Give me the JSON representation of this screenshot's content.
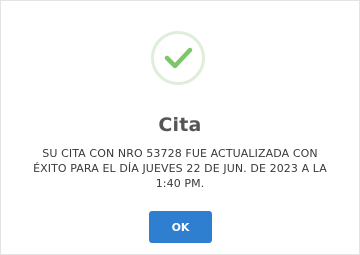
{
  "dialog": {
    "icon": "checkmark-success-icon",
    "title": "Cita",
    "message": "SU CITA CON NRO 53728 FUE ACTUALIZADA CON\nÉXITO PARA EL DÍA JUEVES 22 DE JUN. DE 2023 A LA\n1:40 PM.",
    "ok_label": "OK"
  },
  "colors": {
    "accent": "#2f7fd0",
    "success": "#7cc66a",
    "success_ring": "#dfeedb",
    "title_text": "#555555"
  }
}
